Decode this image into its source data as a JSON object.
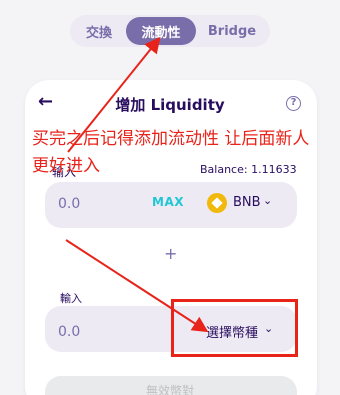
{
  "tabs": [
    {
      "label": "交換"
    },
    {
      "label": "流動性"
    },
    {
      "label": "Bridge"
    }
  ],
  "card": {
    "title": "增加 Liquidity",
    "help_icon": "?"
  },
  "annotation": {
    "text": "买完之后记得添加流动性 让后面新人更好进入",
    "color": "#e8231a"
  },
  "input1": {
    "label": "输入",
    "balance": "Balance: 1.11633",
    "amount": "0.0",
    "max_label": "MAX",
    "token": "BNB"
  },
  "plus_sign": "+",
  "input2": {
    "label": "輸入",
    "amount": "0.0",
    "select_label": "選擇幣種"
  },
  "bottom_button": {
    "label": "無效幣對"
  },
  "colors": {
    "accent": "#7a6eaa",
    "primary_text": "#280d5f",
    "cyan": "#1fc7d4",
    "bnb": "#f0b90b"
  }
}
